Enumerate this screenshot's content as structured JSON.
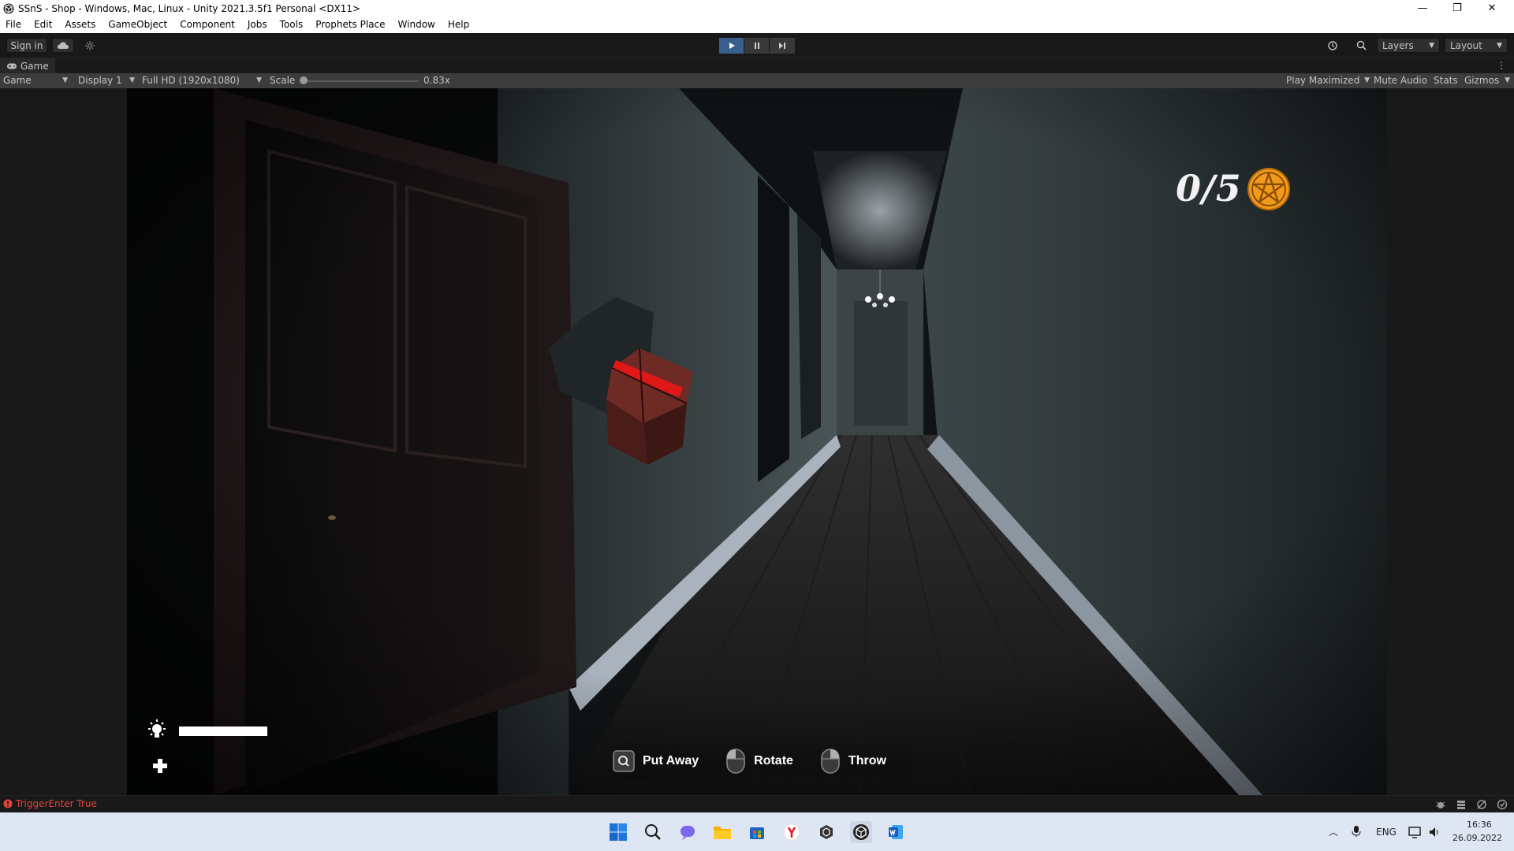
{
  "window": {
    "title": "SSnS - Shop - Windows, Mac, Linux - Unity 2021.3.5f1 Personal <DX11>",
    "minimize_glyph": "—",
    "restore_glyph": "❐",
    "close_glyph": "✕"
  },
  "menu": [
    "File",
    "Edit",
    "Assets",
    "GameObject",
    "Component",
    "Jobs",
    "Tools",
    "Prophets Place",
    "Window",
    "Help"
  ],
  "toolbar": {
    "sign_in": "Sign in",
    "layers": "Layers",
    "layout": "Layout",
    "play_state": "playing"
  },
  "game_tab": {
    "label": "Game"
  },
  "game_toolbar": {
    "view": "Game",
    "display": "Display 1",
    "resolution": "Full HD (1920x1080)",
    "scale_label": "Scale",
    "scale_value": "0.83x",
    "scale_level": 0,
    "play_mode": "Play Maximized",
    "mute_audio": "Mute Audio",
    "stats": "Stats",
    "gizmos": "Gizmos"
  },
  "hud": {
    "counter": "0/5",
    "light_level": 1.0,
    "prompts": [
      {
        "key": "Q",
        "label": "Put Away"
      },
      {
        "key": "mouse-right",
        "label": "Rotate"
      },
      {
        "key": "mouse-left",
        "label": "Throw"
      }
    ]
  },
  "console": {
    "message": "TriggerEnter True"
  },
  "taskbar": {
    "lang": "ENG",
    "time": "16:36",
    "date": "26.09.2022"
  },
  "colors": {
    "editor_dark": "#191919",
    "play_active": "#3a5f8f",
    "error": "#e0453b",
    "pentagram": "#f29a1a",
    "taskbar": "#dfe6f3"
  }
}
